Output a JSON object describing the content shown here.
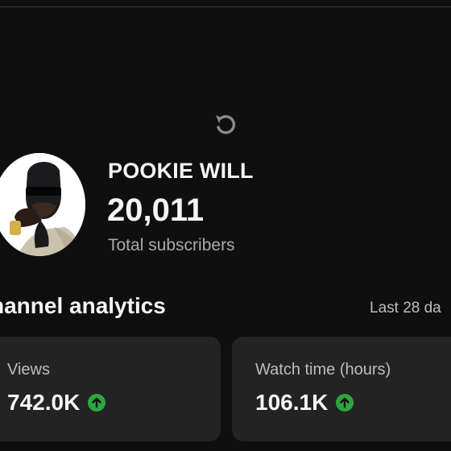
{
  "channel": {
    "name": "POOKIE WILL",
    "subscriber_count": "20,011",
    "subscriber_label": "Total subscribers"
  },
  "analytics": {
    "title": "hannel analytics",
    "period": "Last 28 da",
    "cards": [
      {
        "label": "Views",
        "value": "742.0K",
        "trend": "up",
        "trend_icon": "arrow-up-circle-icon"
      },
      {
        "label": "Watch time (hours)",
        "value": "106.1K",
        "trend": "up",
        "trend_icon": "arrow-up-circle-icon"
      }
    ]
  },
  "colors": {
    "background": "#0f0f0f",
    "card": "#232323",
    "trend_up": "#2ba640",
    "muted_text": "#aaaaaa"
  }
}
